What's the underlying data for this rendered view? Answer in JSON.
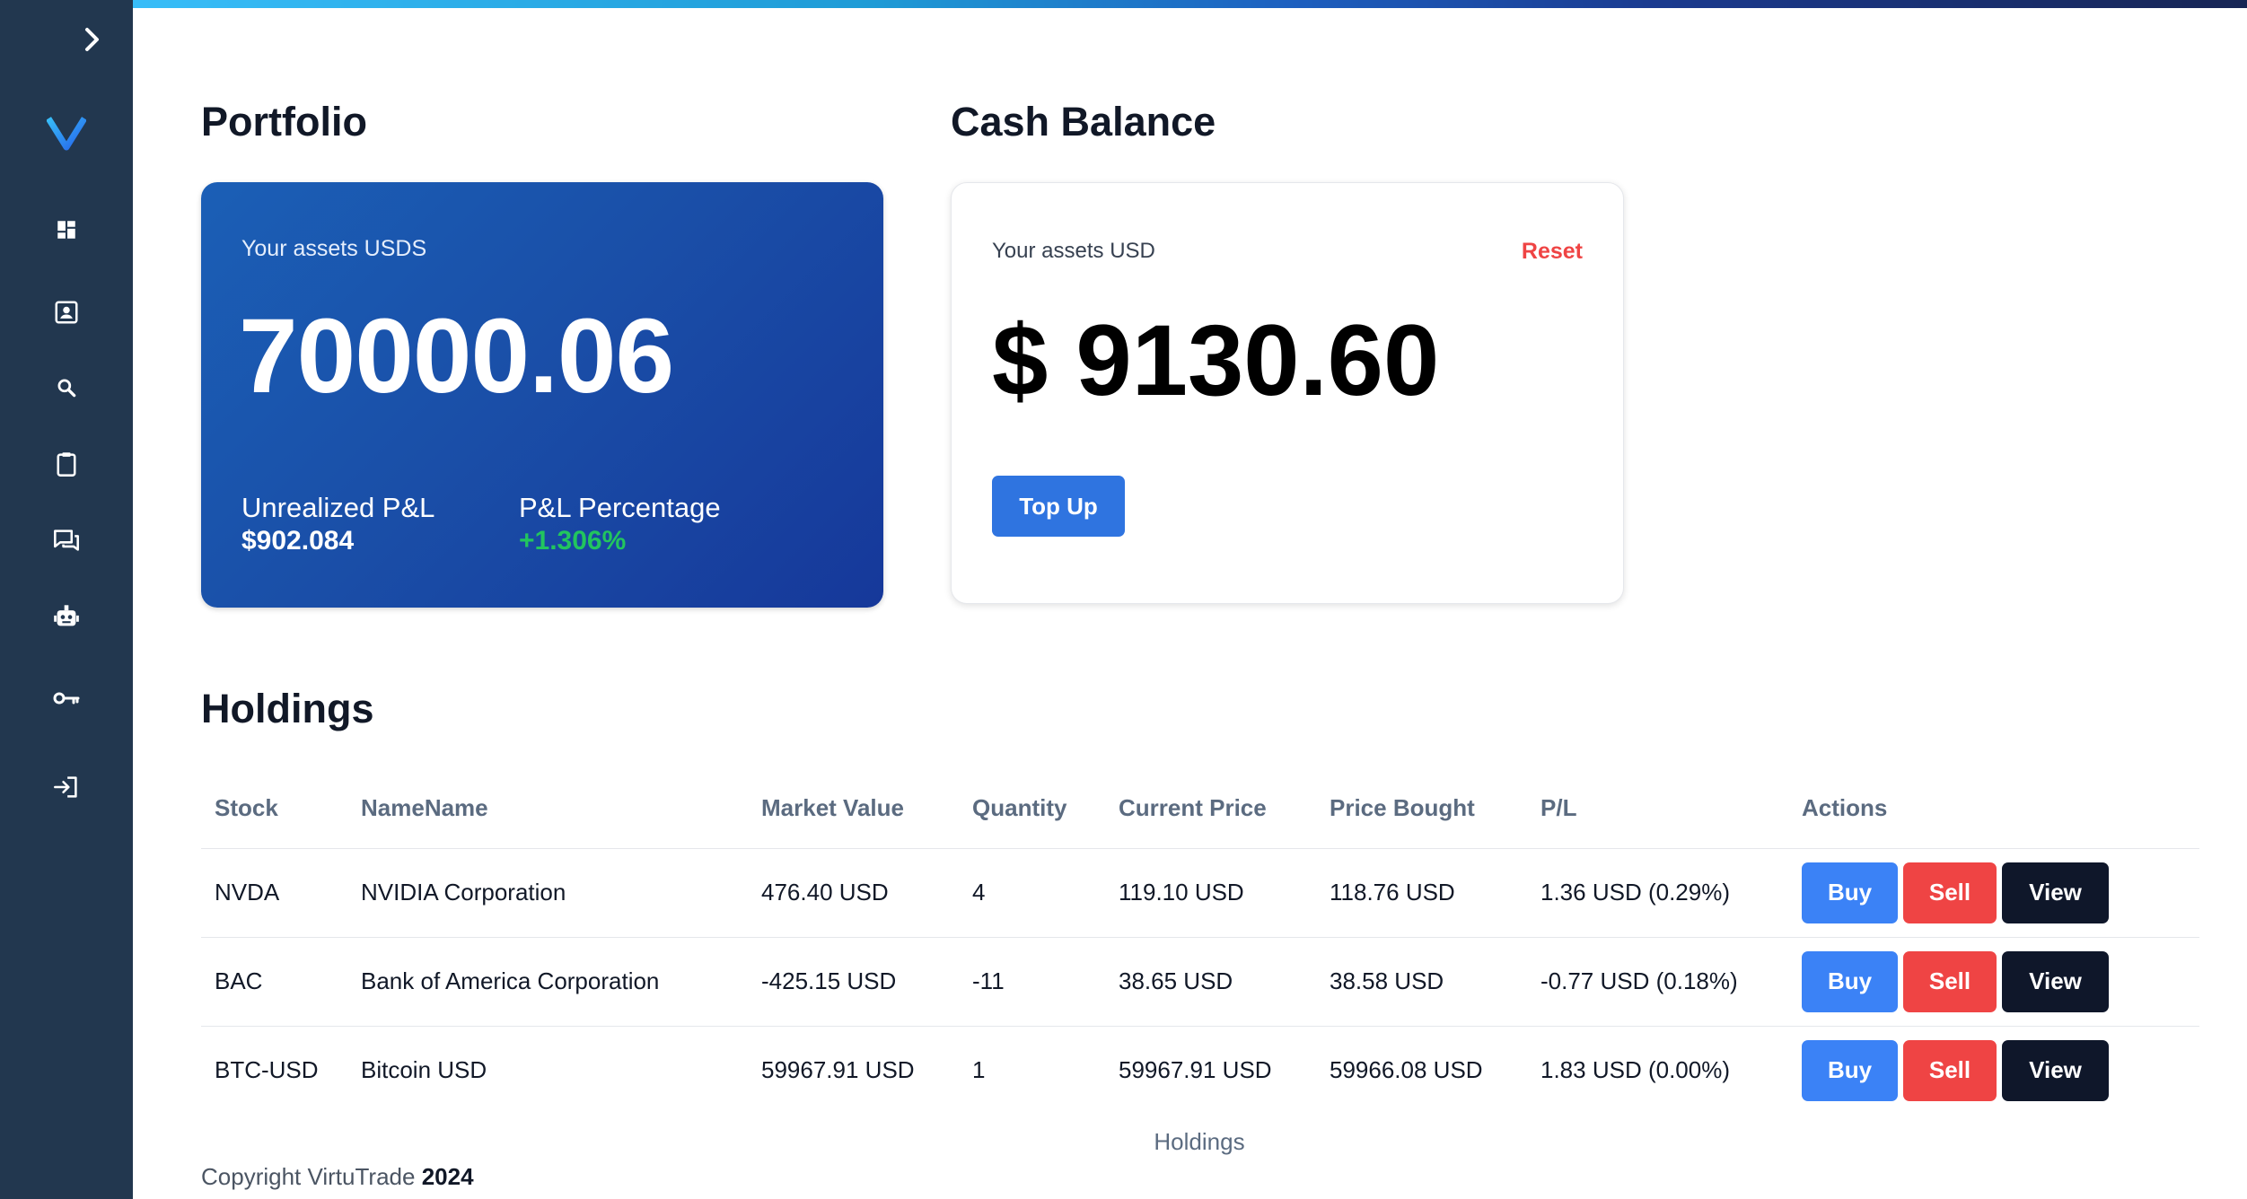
{
  "sidebar": {
    "toggle_icon": "chevron-right-icon",
    "logo_text": "V",
    "items": [
      {
        "name": "dashboard",
        "icon": "dashboard-icon"
      },
      {
        "name": "contacts",
        "icon": "contact-card-icon"
      },
      {
        "name": "search",
        "icon": "search-icon"
      },
      {
        "name": "orders",
        "icon": "clipboard-icon"
      },
      {
        "name": "forum",
        "icon": "chat-icon"
      },
      {
        "name": "bot",
        "icon": "robot-icon"
      },
      {
        "name": "keys",
        "icon": "key-icon"
      },
      {
        "name": "logout",
        "icon": "logout-icon"
      }
    ]
  },
  "portfolio": {
    "title": "Portfolio",
    "assets_label": "Your assets USDS",
    "assets_value": "70000.06",
    "unrealized_label": "Unrealized P&L",
    "unrealized_value": "$902.084",
    "pct_label": "P&L Percentage",
    "pct_value": "+1.306%"
  },
  "cash": {
    "title": "Cash Balance",
    "assets_label": "Your assets USD",
    "reset_label": "Reset",
    "value": "$ 9130.60",
    "topup_label": "Top Up"
  },
  "holdings": {
    "title": "Holdings",
    "columns": [
      "Stock",
      "NameName",
      "Market Value",
      "Quantity",
      "Current Price",
      "Price Bought",
      "P/L",
      "Actions"
    ],
    "rows": [
      {
        "stock": "NVDA",
        "name": "NVIDIA Corporation",
        "market_value": "476.40 USD",
        "quantity": "4",
        "current_price": "119.10 USD",
        "price_bought": "118.76 USD",
        "pl": "1.36 USD (0.29%)",
        "pl_sign": "positive"
      },
      {
        "stock": "BAC",
        "name": "Bank of America Corporation",
        "market_value": "-425.15 USD",
        "quantity": "-11",
        "current_price": "38.65 USD",
        "price_bought": "38.58 USD",
        "pl": "-0.77 USD (0.18%)",
        "pl_sign": "negative"
      },
      {
        "stock": "BTC-USD",
        "name": "Bitcoin USD",
        "market_value": "59967.91 USD",
        "quantity": "1",
        "current_price": "59967.91 USD",
        "price_bought": "59966.08 USD",
        "pl": "1.83 USD (0.00%)",
        "pl_sign": "positive"
      }
    ],
    "actions": {
      "buy": "Buy",
      "sell": "Sell",
      "view": "View"
    },
    "caption": "Holdings"
  },
  "footer": {
    "copyright": "Copyright VirtuTrade",
    "year": "2024"
  },
  "colors": {
    "sidebar_bg": "#22374f",
    "accent_blue": "#2f74e0",
    "positive": "#22a04b",
    "negative": "#ef4444",
    "dark_button": "#0f172a"
  }
}
